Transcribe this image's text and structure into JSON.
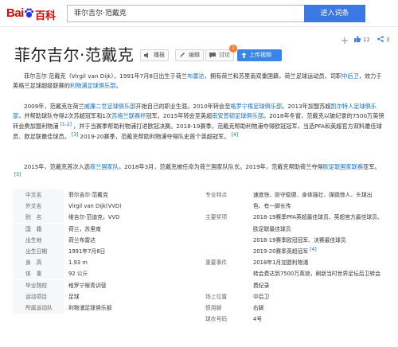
{
  "header": {
    "logo_text": "Bai",
    "logo_suffix": "百科",
    "search_value": "菲尔吉尔·范戴克",
    "search_button": "进入词条"
  },
  "title": {
    "text": "菲尔吉尔·范戴克",
    "buttons": [
      "播报",
      "编辑",
      "讨论",
      "上传视频"
    ],
    "discuss_badge": "1",
    "likes": "12",
    "shares": "3"
  },
  "paragraphs": {
    "p1": [
      {
        "t": "菲尔吉尔·范戴克（Virgil van Dijk），1991年7月8日出生于荷兰"
      },
      {
        "t": "布雷达",
        "link": true
      },
      {
        "t": "，拥有荷兰和苏里南双重国籍，荷兰足球运动员，司职"
      },
      {
        "t": "中后卫",
        "link": true
      },
      {
        "t": "，效力于英格兰足球超级联赛的"
      },
      {
        "t": "利物浦足球俱乐部",
        "link": true
      },
      {
        "t": "。"
      }
    ],
    "p2": [
      {
        "t": "2009年，范戴克在荷兰"
      },
      {
        "t": "威廉二世足球俱乐部",
        "link": true
      },
      {
        "t": "开始自己的职业生涯。2010年转会至"
      },
      {
        "t": "格罗宁根足球俱乐部",
        "link": true
      },
      {
        "t": "。2013年加盟苏超"
      },
      {
        "t": "凯尔特人足球俱乐部",
        "link": true
      },
      {
        "t": "，并帮助球队夺得2次苏超冠军和1次"
      },
      {
        "t": "苏格兰联赛杯",
        "link": true
      },
      {
        "t": "冠军。2015年转会至英超"
      },
      {
        "t": "南安普顿足球俱乐部",
        "link": true
      },
      {
        "t": "。2018年冬窗，范戴克以破纪录的7500万英镑转会费加盟利物浦"
      },
      {
        "t": "[1-2]",
        "sup": true
      },
      {
        "t": "，并于当赛季帮助利物浦打进欧冠决赛。2018-19赛季，范戴克帮助利物浦夺得欧冠冠军，当选PFA和英超官方双料最佳球员、欧足联最佳球员。"
      },
      {
        "t": "[3]",
        "sup": true
      },
      {
        "t": "2019-20赛季，范戴克帮助利物浦夺得队史首个英超冠军。"
      },
      {
        "t": "[4]",
        "sup": true
      }
    ],
    "p3": [
      {
        "t": "2015年，范戴克首次入选"
      },
      {
        "t": "荷兰国家队",
        "link": true
      },
      {
        "t": "。2018年3月，范戴克被任命为荷兰国家队队长。2019年，范戴克帮助荷兰夺得"
      },
      {
        "t": "欧足联国家联赛",
        "link": true
      },
      {
        "t": "亚军。"
      },
      {
        "t": "[5]",
        "sup": true
      }
    ]
  },
  "infobox": {
    "left": [
      {
        "label": "中文名",
        "value": "菲尔吉尔·范戴克"
      },
      {
        "label": "外文名",
        "value": "Virgil van Dijk(VVD)"
      },
      {
        "label": "别　名",
        "value": "维吉尔·范迪克，VVD"
      },
      {
        "label": "国　籍",
        "value": "荷兰，苏里南",
        "link": true
      },
      {
        "label": "出生地",
        "value": "荷兰布雷达"
      },
      {
        "label": "出生日期",
        "value": "1991年7月8日"
      },
      {
        "label": "身　高",
        "value": "1.93 m"
      },
      {
        "label": "体　重",
        "value": "92 公斤"
      },
      {
        "label": "毕业院校",
        "value": "格罗宁根青训营"
      },
      {
        "label": "运动项目",
        "value": "足球",
        "link": true
      },
      {
        "label": "所属运动队",
        "value": "利物浦足球俱乐部"
      }
    ],
    "right": [
      {
        "label": "专业特点",
        "value": "速度快、防守稳健、身体强壮、弹跳惊人、头球出"
      },
      {
        "label": "",
        "value": "色、有一脚长传"
      },
      {
        "label": "主要奖项",
        "value": "2018-19赛季PFA英超最佳球员、英超官方最佳球员、"
      },
      {
        "label": "",
        "value": "欧足联最佳球员"
      },
      {
        "label": "",
        "value": "2018-19赛季欧冠冠军、决赛最佳球员"
      },
      {
        "label": "",
        "value": "2019-20赛季英超冠军",
        "sup": "[4]"
      },
      {
        "label": "重要事件",
        "value": "2018年1月加盟利物浦"
      },
      {
        "label": "",
        "value": "转会费达到7500万英镑，刷新当时世界足坛后卫转会"
      },
      {
        "label": "",
        "value": "费纪录"
      },
      {
        "label": "场上位置",
        "value": "中后卫"
      },
      {
        "label": "惯用脚",
        "value": "右脚"
      },
      {
        "label": "球衣号码",
        "value": "4号"
      }
    ]
  },
  "colors": {
    "brand_red": "#e10601",
    "search_blue": "#3a78e3",
    "link_blue": "#136ec2",
    "badge_orange": "#f57b2d"
  }
}
